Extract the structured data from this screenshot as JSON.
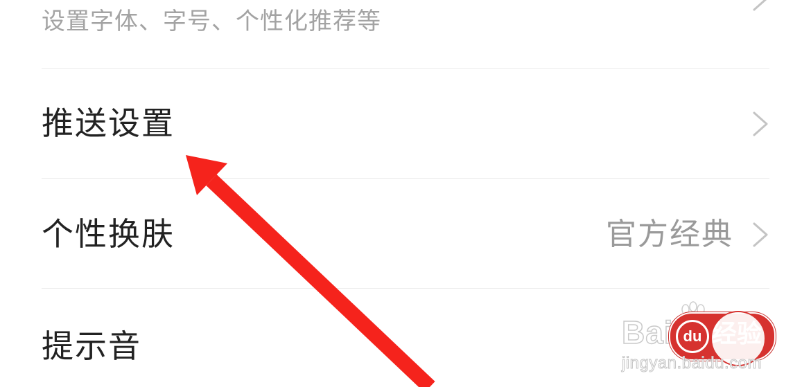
{
  "settings": {
    "display": {
      "subtitle": "设置字体、字号、个性化推荐等"
    },
    "push": {
      "label": "推送设置"
    },
    "skin": {
      "label": "个性换肤",
      "value": "官方经典"
    },
    "sound": {
      "label": "提示音"
    }
  },
  "icons": {
    "chevron": "chevron-right-icon",
    "arrow": "red-annotation-arrow"
  },
  "watermark": {
    "brand": "Bai",
    "badge_du": "du",
    "badge_text": "经验",
    "url": "jingyan.baidu.com"
  },
  "colors": {
    "arrow": "#f5231c",
    "watermark_red": "#d6322f",
    "label": "#222222",
    "secondary": "#9a9a9a"
  }
}
